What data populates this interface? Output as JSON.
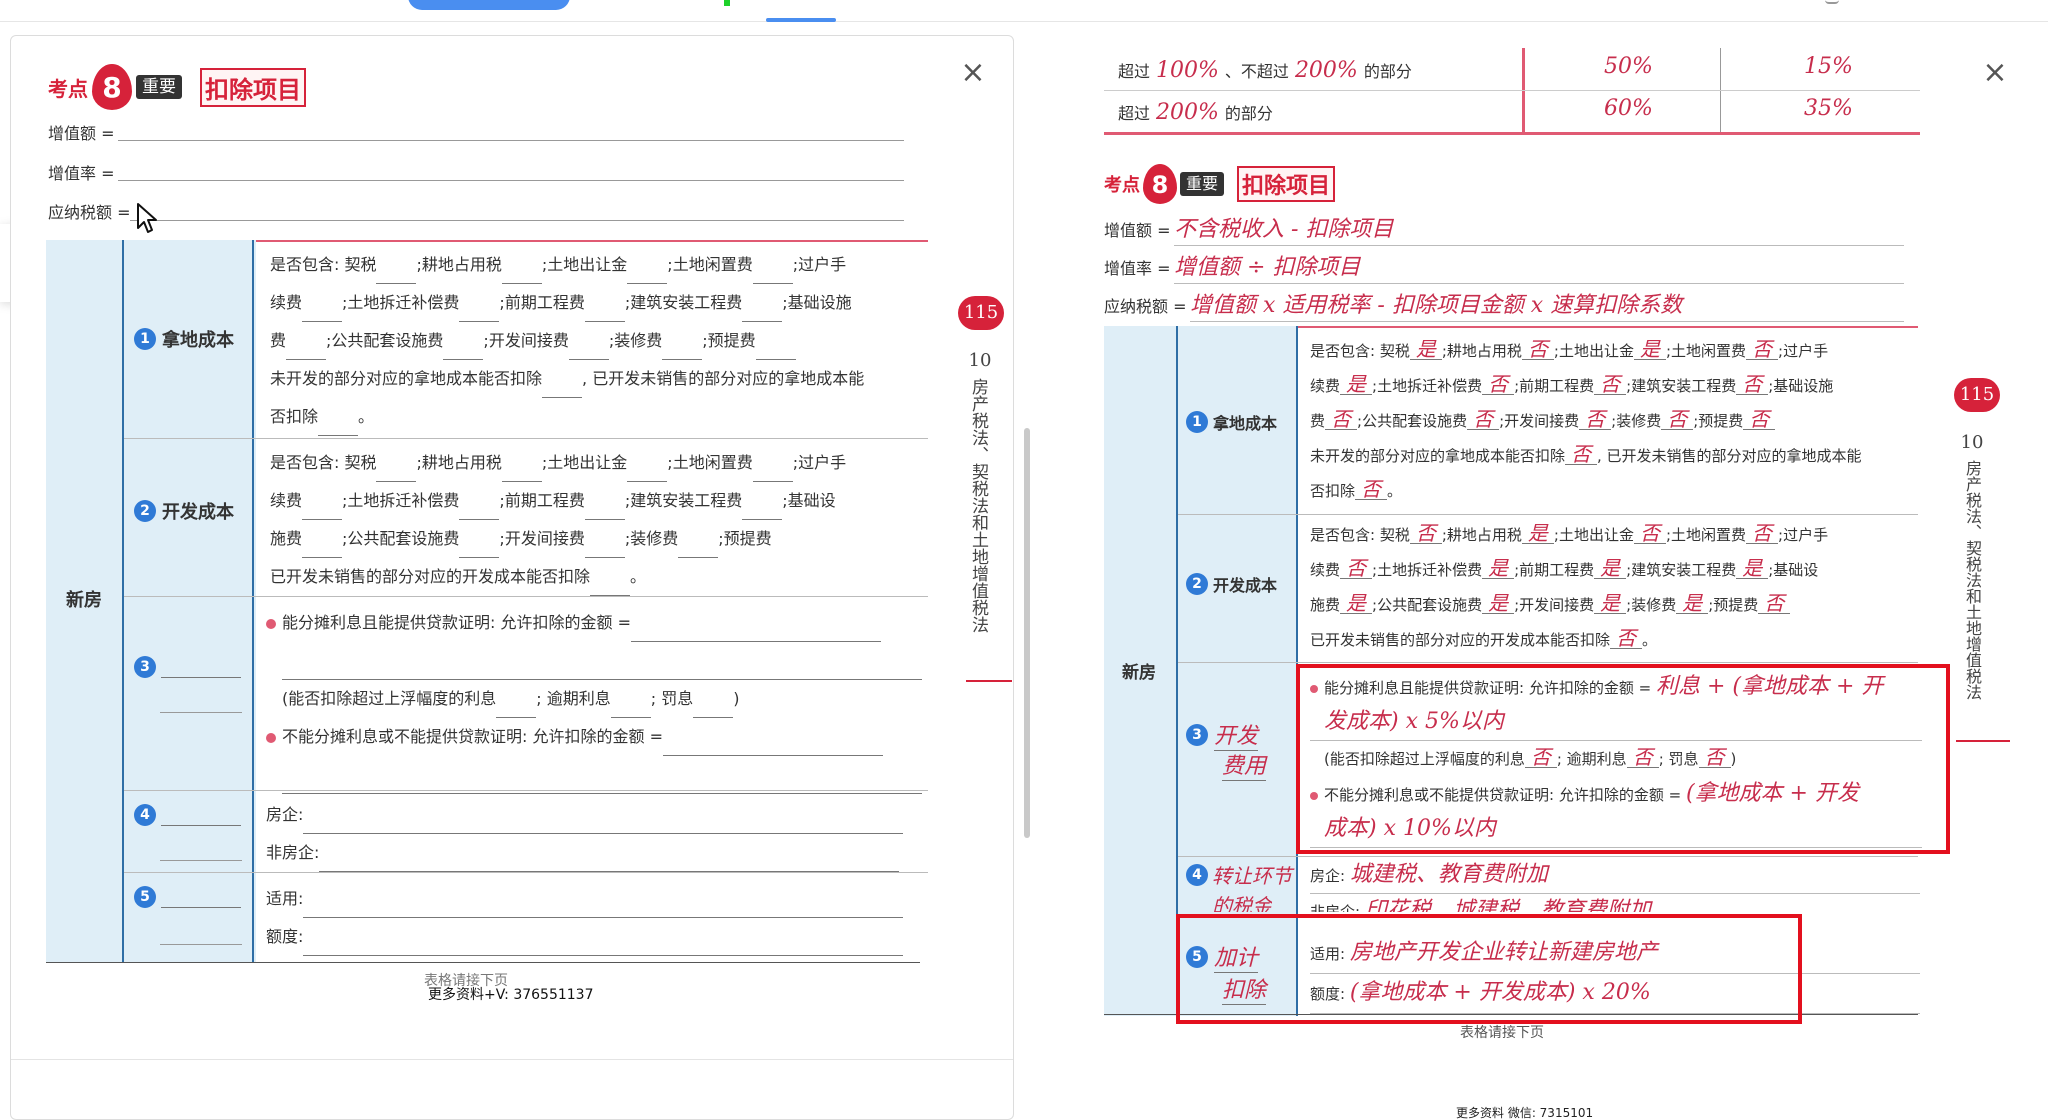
{
  "left": {
    "kaodian_label": "考点",
    "kaodian_number": "8",
    "importance": "重要",
    "title": "扣除项目",
    "formulas": [
      {
        "label": "增值额 ="
      },
      {
        "label": "增值率 ="
      },
      {
        "label": "应纳税额 ="
      }
    ],
    "category": "新房",
    "rows": {
      "r1_title": "拿地成本",
      "r1_num": "1",
      "r1_l1_prefix": "是否包含: 契税",
      "r1_l1_a": ";耕地占用税",
      "r1_l1_b": ";土地出让金",
      "r1_l1_c": ";土地闲置费",
      "r1_l1_d": ";过户手",
      "r1_l2_prefix": "续费",
      "r1_l2_a": ";土地拆迁补偿费",
      "r1_l2_b": ";前期工程费",
      "r1_l2_c": ";建筑安装工程费",
      "r1_l2_d": ";基础设施",
      "r1_l3_prefix": "费",
      "r1_l3_a": ";公共配套设施费",
      "r1_l3_b": ";开发间接费",
      "r1_l3_c": ";装修费",
      "r1_l3_d": ";预提费",
      "r1_l4": "未开发的部分对应的拿地成本能否扣除",
      "r1_l4_b": ", 已开发未销售的部分对应的拿地成本能",
      "r1_l5": "否扣除",
      "r1_l5_end": "。",
      "r2_title": "开发成本",
      "r2_num": "2",
      "r2_l1_prefix": "是否包含: 契税",
      "r2_l1_a": ";耕地占用税",
      "r2_l1_b": ";土地出让金",
      "r2_l1_c": ";土地闲置费",
      "r2_l1_d": ";过户手",
      "r2_l2_prefix": "续费",
      "r2_l2_a": ";土地拆迁补偿费",
      "r2_l2_b": ";前期工程费",
      "r2_l2_c": ";建筑安装工程费",
      "r2_l2_d": ";基础设",
      "r2_l3_prefix": "施费",
      "r2_l3_a": ";公共配套设施费",
      "r2_l3_b": ";开发间接费",
      "r2_l3_c": ";装修费",
      "r2_l3_d": ";预提费",
      "r2_l4": "已开发未销售的部分对应的开发成本能否扣除",
      "r2_l4_end": "。",
      "r3_num": "3",
      "r3_bullet1": "能分摊利息且能提供贷款证明: 允许扣除的金额 =",
      "r3_paren_a": "(能否扣除超过上浮幅度的利息",
      "r3_paren_b": "; 逾期利息",
      "r3_paren_c": "; 罚息",
      "r3_paren_d": ")",
      "r3_bullet2": "不能分摊利息或不能提供贷款证明: 允许扣除的金额 =",
      "r4_num": "4",
      "r4_a": "房企:",
      "r4_b": "非房企:",
      "r5_num": "5",
      "r5_a": "适用:",
      "r5_b": "额度:"
    },
    "continue": "表格请接下页",
    "watermark": "更多资料+V: 376551137",
    "side_page": "115",
    "side_chapter": "10",
    "side_text": "房产税法、契税法和土地增值税法"
  },
  "right": {
    "top_rows": [
      {
        "label_a": "超过",
        "v1": "100%",
        "mid": "、不超过",
        "v2": "200%",
        "tail": "的部分",
        "rate": "50%",
        "coef": "15%"
      },
      {
        "label_a": "超过",
        "v1": "200%",
        "tail": "的部分",
        "rate": "60%",
        "coef": "35%"
      }
    ],
    "kaodian_label": "考点",
    "kaodian_number": "8",
    "importance": "重要",
    "title": "扣除项目",
    "formulas": [
      {
        "label": "增值额 =",
        "answer": "不含税收入 - 扣除项目"
      },
      {
        "label": "增值率 =",
        "answer": "增值额 ÷ 扣除项目"
      },
      {
        "label": "应纳税额 =",
        "answer": "增值额 x 适用税率 - 扣除项目金额 x 速算扣除系数"
      }
    ],
    "category": "新房",
    "r1": {
      "num": "1",
      "title": "拿地成本",
      "l1": [
        "是否包含: 契税",
        "是",
        ";耕地占用税",
        "否",
        ";土地出让金",
        "是",
        ";土地闲置费",
        "否",
        ";过户手"
      ],
      "l2": [
        "续费",
        "是",
        ";土地拆迁补偿费",
        "否",
        ";前期工程费",
        "否",
        ";建筑安装工程费",
        "否",
        ";基础设施"
      ],
      "l3": [
        "费",
        "否",
        ";公共配套设施费",
        "否",
        ";开发间接费",
        "否",
        ";装修费",
        "否",
        ";预提费",
        "否"
      ],
      "l4": [
        "未开发的部分对应的拿地成本能否扣除",
        "否",
        ", 已开发未销售的部分对应的拿地成本能"
      ],
      "l5": [
        "否扣除",
        "否",
        "。"
      ]
    },
    "r2": {
      "num": "2",
      "title": "开发成本",
      "l1": [
        "是否包含: 契税",
        "否",
        ";耕地占用税",
        "是",
        ";土地出让金",
        "否",
        ";土地闲置费",
        "否",
        ";过户手"
      ],
      "l2": [
        "续费",
        "否",
        ";土地拆迁补偿费",
        "是",
        ";前期工程费",
        "是",
        ";建筑安装工程费",
        "是",
        ";基础设"
      ],
      "l3": [
        "施费",
        "是",
        ";公共配套设施费",
        "是",
        ";开发间接费",
        "是",
        ";装修费",
        "是",
        ";预提费",
        "否"
      ],
      "l4": [
        "已开发未销售的部分对应的开发成本能否扣除",
        "否",
        "。"
      ]
    },
    "r3": {
      "num": "3",
      "title_a": "开发",
      "title_b": "费用",
      "b1_label": "能分摊利息且能提供贷款证明: 允许扣除的金额 =",
      "b1_ans_a": "利息 + (拿地成本 + 开",
      "b1_ans_b": "发成本) x 5%以内",
      "paren": [
        "(能否扣除超过上浮幅度的利息",
        "否",
        "; 逾期利息",
        "否",
        "; 罚息",
        "否",
        ")"
      ],
      "b2_label": "不能分摊利息或不能提供贷款证明: 允许扣除的金额 =",
      "b2_ans_a": "(拿地成本 + 开发",
      "b2_ans_b": "成本) x 10%以内"
    },
    "r4": {
      "num": "4",
      "title_a": "转让环节",
      "title_b": "的税金",
      "a_label": "房企:",
      "a_ans": "城建税、教育费附加",
      "b_label": "非房企:",
      "b_ans": "印花税、城建税、教育费附加"
    },
    "r5": {
      "num": "5",
      "title_a": "加计",
      "title_b": "扣除",
      "a_label": "适用:",
      "a_ans": "房地产开发企业转让新建房地产",
      "b_label": "额度:",
      "b_ans": "(拿地成本 + 开发成本) x 20%"
    },
    "continue": "表格请接下页",
    "watermark": "更多资料 微信: 7315101",
    "side_page": "115",
    "side_chapter": "10",
    "side_text": "房产税法、契税法和土地增值税法"
  },
  "ui": {
    "close_glyph": "×",
    "h1_label": "H1"
  },
  "colors": {
    "accent_red": "#d6223a",
    "highlight_box": "#e3101e",
    "table_blue": "#dfeef7",
    "handwriting": "#c72d4c"
  }
}
